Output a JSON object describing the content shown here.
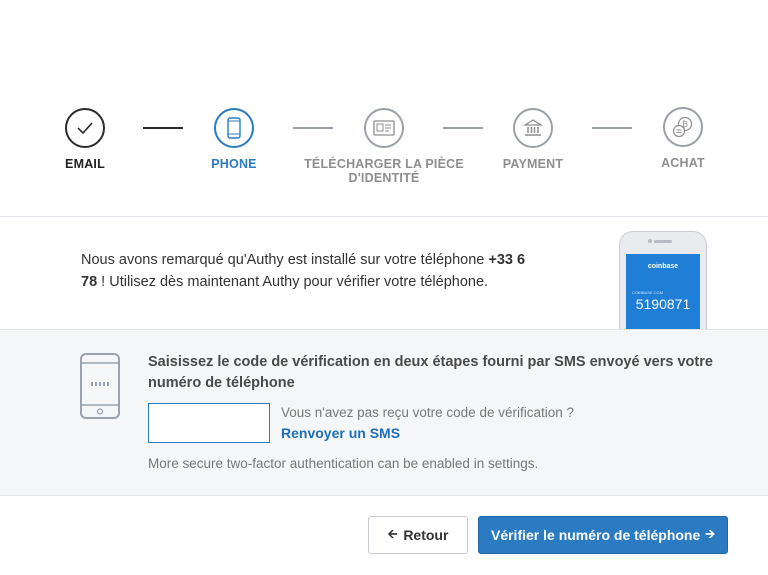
{
  "stepper": {
    "steps": [
      {
        "label": "EMAIL",
        "state": "done",
        "icon": "check-icon"
      },
      {
        "label": "PHONE",
        "state": "active",
        "icon": "phone-icon"
      },
      {
        "label": "TÉLÉCHARGER LA PIÈCE D'IDENTITÉ",
        "state": "pending",
        "icon": "id-card-icon"
      },
      {
        "label": "PAYMENT",
        "state": "pending",
        "icon": "bank-icon"
      },
      {
        "label": "ACHAT",
        "state": "pending",
        "icon": "bitcoin-coins-icon"
      }
    ]
  },
  "authy_notice": {
    "text_before": "Nous avons remarqué qu'Authy est installé sur votre téléphone ",
    "phone_number": "+33 6 78",
    "text_after": " ! Utilisez dès maintenant Authy pour vérifier votre téléphone.",
    "image": {
      "brand": "coinbase",
      "small_label": "COINBASE.COM",
      "code": "5190871"
    }
  },
  "verification": {
    "heading": "Saisissez le code de vérification en deux étapes fourni par SMS envoyé vers votre numéro de téléphone",
    "code_input_value": "",
    "no_code_text": "Vous n'avez pas reçu votre code de vérification ?",
    "resend_link": "Renvoyer un SMS",
    "more_secure_text": "More secure two-factor authentication can be enabled in settings."
  },
  "footer": {
    "back_label": "Retour",
    "verify_label": "Vérifier le numéro de téléphone"
  },
  "colors": {
    "accent": "#2a7bc1",
    "done": "#2b2b2b",
    "pending": "#9aa0a6",
    "panel_bg": "#f5f6f7"
  }
}
